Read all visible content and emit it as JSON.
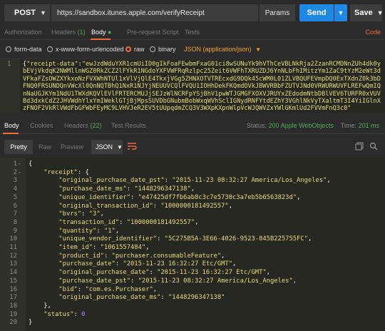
{
  "request": {
    "method": "POST",
    "url": "https://sandbox.itunes.apple.com/verifyReceipt",
    "params_label": "Params",
    "send_label": "Send",
    "save_label": "Save"
  },
  "request_tabs": {
    "authorization": "Authorization",
    "headers": "Headers",
    "headers_count": "(1)",
    "body": "Body",
    "prerequest": "Pre-request Script",
    "tests": "Tests",
    "code": "Code"
  },
  "body_types": {
    "form_data": "form-data",
    "urlencoded": "x-www-form-urlencoded",
    "raw": "raw",
    "binary": "binary",
    "content_type": "JSON (application/json)"
  },
  "request_body": {
    "line_number": "1",
    "brace": "{",
    "key": "\"receipt-data\"",
    "colon": ":",
    "value": "\"ewJzdWduYXR1cmUiID0gIkFoaFEwbmFxaG01ci8wSUNuYk9hVThCeVBLNkRja2ZzanRCMDNnZUh4dk0ybEVjVkdqK2NWMllnWGZ0RkZCZ2lFYkR1NGdoYXFVWFRqRzlpc25Zeit6VWFhTXRUZDJ6YnNLbFhIMitzYm1ZaC9tYzM2eWt3dVFkaFZsOWZXYkxoNzFVXWhNTUl1xVlVjQlE4TkxjVGg5ZHNXOTVTREcxdG9DQk45cWM0L01ZLVBQUFEVmpDQ0ExTXdnZ0k3bDFNQ0FRSUNDQnVWcXl0QnNQTBhQ1NxR1NJYjNEUUVCQlFVQU1IOHhDekFKQmdOVkJBWVRBbFZUTVJNd0VRWURWUVFLREFwQmIQnNaUGJKYm1NdU1TWXdKQVlEVlFRTERCMUJjSEJzWlNCRFpYSjBhV1pwWTJGMGFXOXVJRUYxZEdodmNtbDBlVEV6TURFR0xVUVBd3dxkCdZ2JHVWdhYlxYmIWeklGTjBjMpsSUVDbGNubmBobWxqWVhSclIGNydRNFYtdEZhY3VGhlNkVyTXaltmT3I4YiIGlnXzFNOF2VkRlVWdFbGFWbFEyMC9LVHVJeR2EV5tUUpqdmZCQ3V3WXpKXpnWlpVcWJQWVZxYWlGKmlUd2FVVmFnQ3c0\""
  },
  "response_tabs": {
    "body": "Body",
    "cookies": "Cookies",
    "headers": "Headers",
    "headers_count": "(22)",
    "test_results": "Test Results",
    "status_label": "Status:",
    "status_value": "200 Apple WebObjects",
    "time_label": "Time:",
    "time_value": "201 ms"
  },
  "response_view": {
    "pretty": "Pretty",
    "raw": "Raw",
    "preview": "Preview",
    "format": "JSON"
  },
  "response_lines": [
    {
      "n": "1",
      "fold": "-",
      "indent": "",
      "key": "",
      "val": "",
      "punct": "{",
      "vtype": ""
    },
    {
      "n": "2",
      "fold": "-",
      "indent": "    ",
      "key": "\"receipt\"",
      "val": "",
      "punct": ": {",
      "vtype": ""
    },
    {
      "n": "3",
      "fold": "",
      "indent": "        ",
      "key": "\"original_purchase_date_pst\"",
      "val": "\"2015-11-23 08:32:27 America/Los_Angeles\"",
      "punct": ",",
      "vtype": "str"
    },
    {
      "n": "4",
      "fold": "",
      "indent": "        ",
      "key": "\"purchase_date_ms\"",
      "val": "\"1448296347138\"",
      "punct": ",",
      "vtype": "str"
    },
    {
      "n": "5",
      "fold": "",
      "indent": "        ",
      "key": "\"unique_identifier\"",
      "val": "\"e47425df7fb6ab8c3c7e5730c3a7eb5b6563823d\"",
      "punct": ",",
      "vtype": "str"
    },
    {
      "n": "6",
      "fold": "",
      "indent": "        ",
      "key": "\"original_transaction_id\"",
      "val": "\"1000000181492557\"",
      "punct": ",",
      "vtype": "str"
    },
    {
      "n": "7",
      "fold": "",
      "indent": "        ",
      "key": "\"bvrs\"",
      "val": "\"3\"",
      "punct": ",",
      "vtype": "str"
    },
    {
      "n": "8",
      "fold": "",
      "indent": "        ",
      "key": "\"transaction_id\"",
      "val": "\"1000000181492557\"",
      "punct": ",",
      "vtype": "str"
    },
    {
      "n": "9",
      "fold": "",
      "indent": "        ",
      "key": "\"quantity\"",
      "val": "\"1\"",
      "punct": ",",
      "vtype": "str"
    },
    {
      "n": "10",
      "fold": "",
      "indent": "        ",
      "key": "\"unique_vendor_identifier\"",
      "val": "\"5C275B5A-3E66-4026-9523-845B225755FC\"",
      "punct": ",",
      "vtype": "str"
    },
    {
      "n": "11",
      "fold": "",
      "indent": "        ",
      "key": "\"item_id\"",
      "val": "\"1061557484\"",
      "punct": ",",
      "vtype": "str"
    },
    {
      "n": "12",
      "fold": "",
      "indent": "        ",
      "key": "\"product_id\"",
      "val": "\"purchaser.consumableFeature\"",
      "punct": ",",
      "vtype": "str"
    },
    {
      "n": "13",
      "fold": "",
      "indent": "        ",
      "key": "\"purchase_date\"",
      "val": "\"2015-11-23 16:32:27 Etc/GMT\"",
      "punct": ",",
      "vtype": "str"
    },
    {
      "n": "14",
      "fold": "",
      "indent": "        ",
      "key": "\"original_purchase_date\"",
      "val": "\"2015-11-23 16:32:27 Etc/GMT\"",
      "punct": ",",
      "vtype": "str"
    },
    {
      "n": "15",
      "fold": "",
      "indent": "        ",
      "key": "\"purchase_date_pst\"",
      "val": "\"2015-11-23 08:32:27 America/Los_Angeles\"",
      "punct": ",",
      "vtype": "str"
    },
    {
      "n": "16",
      "fold": "",
      "indent": "        ",
      "key": "\"bid\"",
      "val": "\"com.es.Purchaser\"",
      "punct": ",",
      "vtype": "str"
    },
    {
      "n": "17",
      "fold": "",
      "indent": "        ",
      "key": "\"original_purchase_date_ms\"",
      "val": "\"1448296347138\"",
      "punct": "",
      "vtype": "str"
    },
    {
      "n": "18",
      "fold": "",
      "indent": "    ",
      "key": "",
      "val": "",
      "punct": "},",
      "vtype": ""
    },
    {
      "n": "19",
      "fold": "",
      "indent": "    ",
      "key": "\"status\"",
      "val": "0",
      "punct": "",
      "vtype": "num"
    },
    {
      "n": "20",
      "fold": "",
      "indent": "",
      "key": "",
      "val": "",
      "punct": "}",
      "vtype": ""
    }
  ],
  "colors": {
    "accent": "#f26b3a",
    "send": "#1e88e5",
    "ok": "#4caf50",
    "string": "#e6db74",
    "number": "#ae81ff"
  }
}
